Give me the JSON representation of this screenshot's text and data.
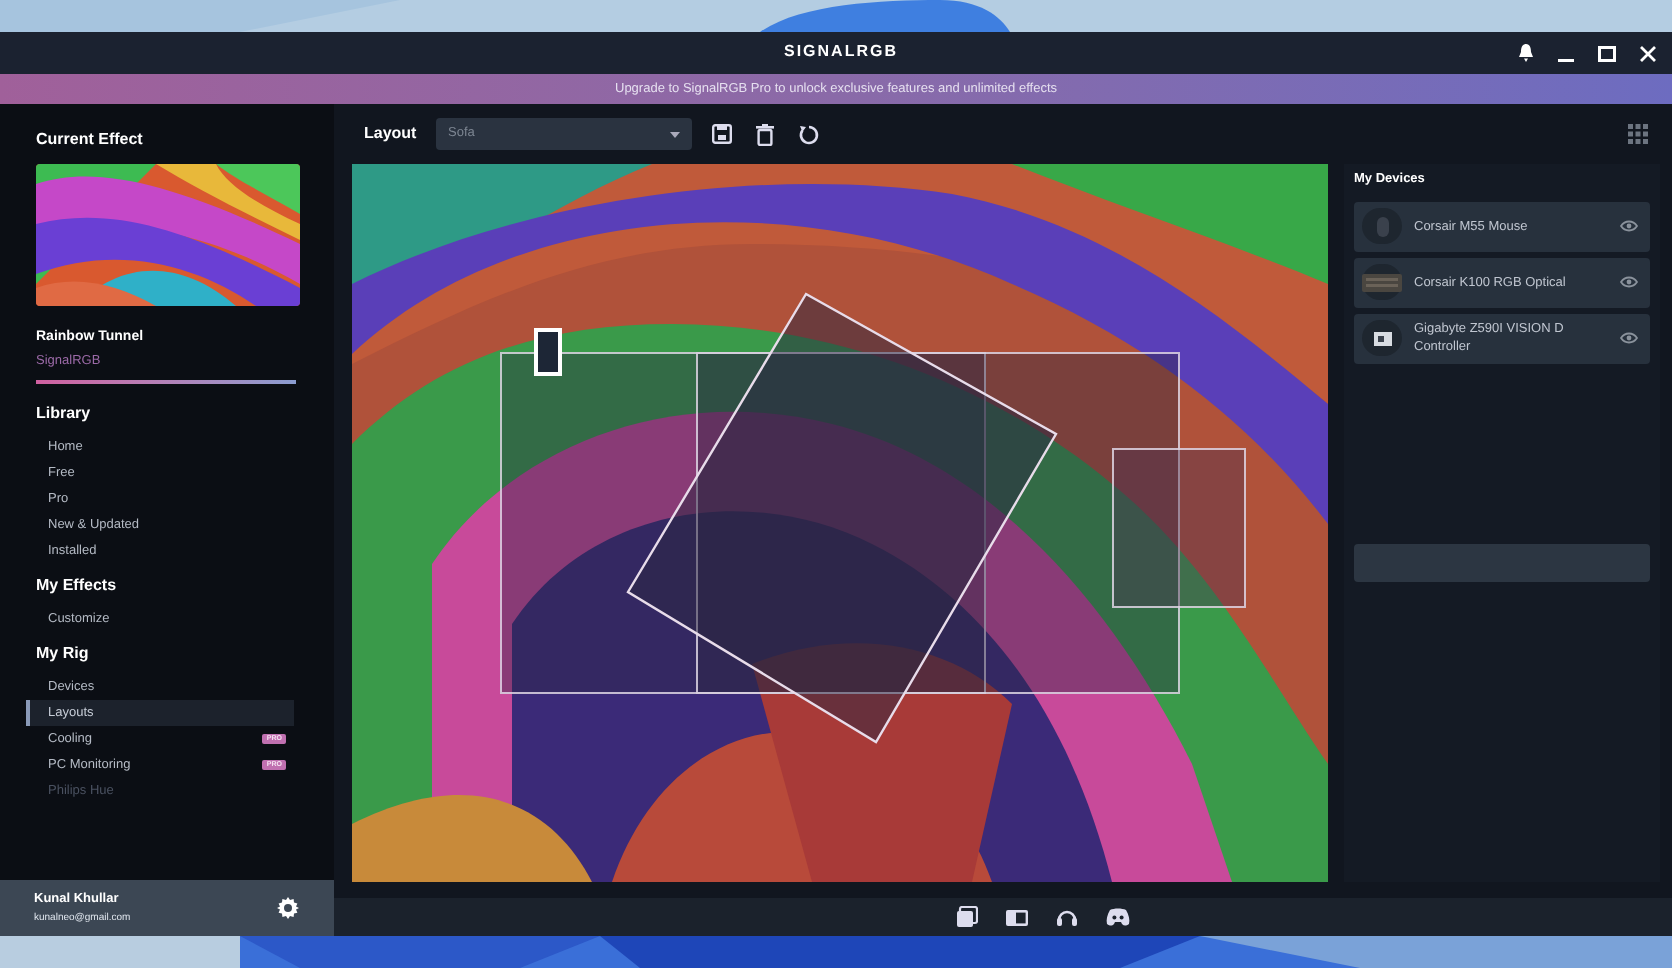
{
  "window": {
    "title": "SIGNALRGB"
  },
  "banner": "Upgrade to SignalRGB Pro to unlock exclusive features and unlimited effects",
  "current_effect": {
    "heading": "Current Effect",
    "name": "Rainbow Tunnel",
    "author": "SignalRGB"
  },
  "sidebar": {
    "sections": [
      {
        "title": "Library",
        "items": [
          {
            "label": "Home",
            "selected": false,
            "disabled": false
          },
          {
            "label": "Free",
            "selected": false,
            "disabled": false
          },
          {
            "label": "Pro",
            "selected": false,
            "disabled": false
          },
          {
            "label": "New & Updated",
            "selected": false,
            "disabled": false
          },
          {
            "label": "Installed",
            "selected": false,
            "disabled": false
          }
        ]
      },
      {
        "title": "My Effects",
        "items": [
          {
            "label": "Customize",
            "selected": false,
            "disabled": false
          }
        ]
      },
      {
        "title": "My Rig",
        "items": [
          {
            "label": "Devices",
            "selected": false,
            "disabled": false
          },
          {
            "label": "Layouts",
            "selected": true,
            "disabled": false
          },
          {
            "label": "Cooling",
            "selected": false,
            "disabled": false,
            "badge": "PRO"
          },
          {
            "label": "PC Monitoring",
            "selected": false,
            "disabled": false,
            "badge": "PRO"
          },
          {
            "label": "Philips Hue",
            "selected": false,
            "disabled": true
          }
        ]
      }
    ]
  },
  "user": {
    "name": "Kunal Khullar",
    "email": "kunalneo@gmail.com"
  },
  "layout": {
    "label": "Layout",
    "value": "Sofa"
  },
  "devices": {
    "title": "My Devices",
    "items": [
      {
        "name": "Corsair M55 Mouse",
        "kind": "mouse"
      },
      {
        "name": "Corsair K100 RGB Optical",
        "kind": "keyboard"
      },
      {
        "name": "Gigabyte Z590I VISION D Controller",
        "kind": "board"
      }
    ]
  }
}
